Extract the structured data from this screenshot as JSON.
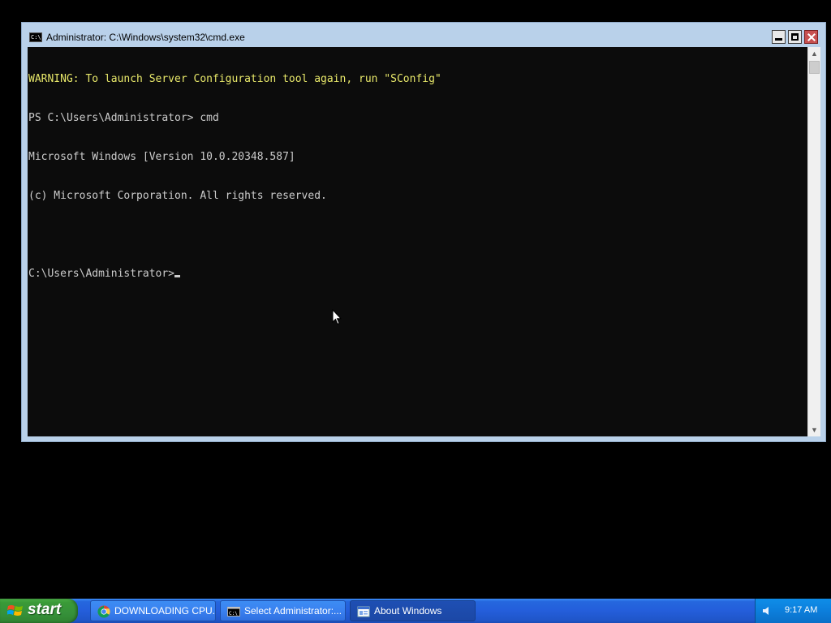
{
  "window": {
    "title": "Administrator: C:\\Windows\\system32\\cmd.exe",
    "icon": "cmd-icon",
    "icon_text": "C:\\",
    "buttons": [
      "minimize",
      "maximize",
      "close"
    ]
  },
  "console": {
    "lines": [
      "WARNING: To launch Server Configuration tool again, run \"SConfig\"",
      "PS C:\\Users\\Administrator> cmd",
      "Microsoft Windows [Version 10.0.20348.587]",
      "(c) Microsoft Corporation. All rights reserved.",
      "",
      "C:\\Users\\Administrator>"
    ],
    "colors": {
      "background": "#0c0c0c",
      "text": "#cccccc",
      "warning": "#e8e86a"
    }
  },
  "taskbar": {
    "start_label": "start",
    "tasks": [
      {
        "label": "DOWNLOADING CPU...",
        "icon": "chrome-icon",
        "active": false
      },
      {
        "label": "Select Administrator:...",
        "icon": "cmd-icon",
        "active": false
      },
      {
        "label": "About Windows",
        "icon": "window-icon",
        "active": true
      }
    ],
    "tray": {
      "icon": "volume-icon",
      "clock": "9:17 AM"
    }
  }
}
